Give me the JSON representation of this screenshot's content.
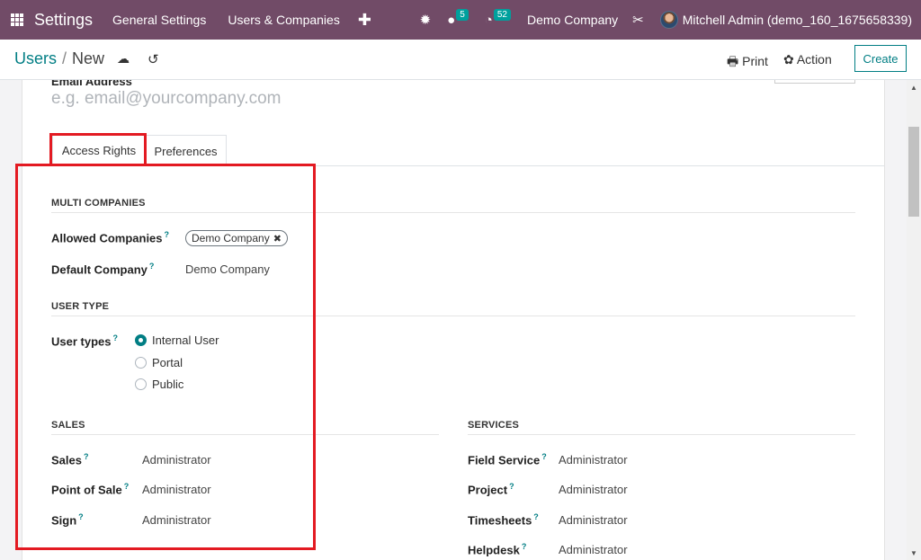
{
  "navbar": {
    "app_name": "Settings",
    "menu": [
      "General Settings",
      "Users & Companies"
    ],
    "plus": "✚",
    "bug_icon": "✹",
    "chat_icon": "●",
    "chat_count": "5",
    "activity_icon": "◔",
    "activity_count": "52",
    "company": "Demo Company",
    "tools_icon": "✂",
    "user": "Mitchell Admin (demo_160_1675658339)"
  },
  "control": {
    "breadcrumb_parent": "Users",
    "breadcrumb_sep": "/",
    "breadcrumb_current": "New",
    "cloud_icon": "☁",
    "discard_icon": "↺",
    "print_label": "🖶 Print",
    "action_label": "✿ Action",
    "create_label": "Create"
  },
  "form": {
    "email_label": "Email Address",
    "email_placeholder": "e.g. email@yourcompany.com",
    "tabs": [
      "Access Rights",
      "Preferences"
    ],
    "help": "?",
    "multi_companies": {
      "title": "MULTI COMPANIES",
      "allowed_label": "Allowed Companies",
      "allowed_tag": "Demo Company",
      "tag_remove": "✖",
      "default_label": "Default Company",
      "default_value": "Demo Company"
    },
    "user_type": {
      "title": "USER TYPE",
      "label": "User types",
      "options": [
        "Internal User",
        "Portal",
        "Public"
      ],
      "selected": "Internal User"
    },
    "sales": {
      "title": "SALES",
      "rows": [
        {
          "label": "Sales",
          "value": "Administrator"
        },
        {
          "label": "Point of Sale",
          "value": "Administrator"
        },
        {
          "label": "Sign",
          "value": "Administrator"
        }
      ]
    },
    "services": {
      "title": "SERVICES",
      "rows": [
        {
          "label": "Field Service",
          "value": "Administrator"
        },
        {
          "label": "Project",
          "value": "Administrator"
        },
        {
          "label": "Timesheets",
          "value": "Administrator"
        },
        {
          "label": "Helpdesk",
          "value": "Administrator"
        }
      ]
    }
  },
  "colors": {
    "brand": "#714b67",
    "accent": "#017e84",
    "highlight": "#e31a22",
    "badge": "#00a09d"
  },
  "scroll": {
    "up": "▲",
    "down": "▼"
  }
}
